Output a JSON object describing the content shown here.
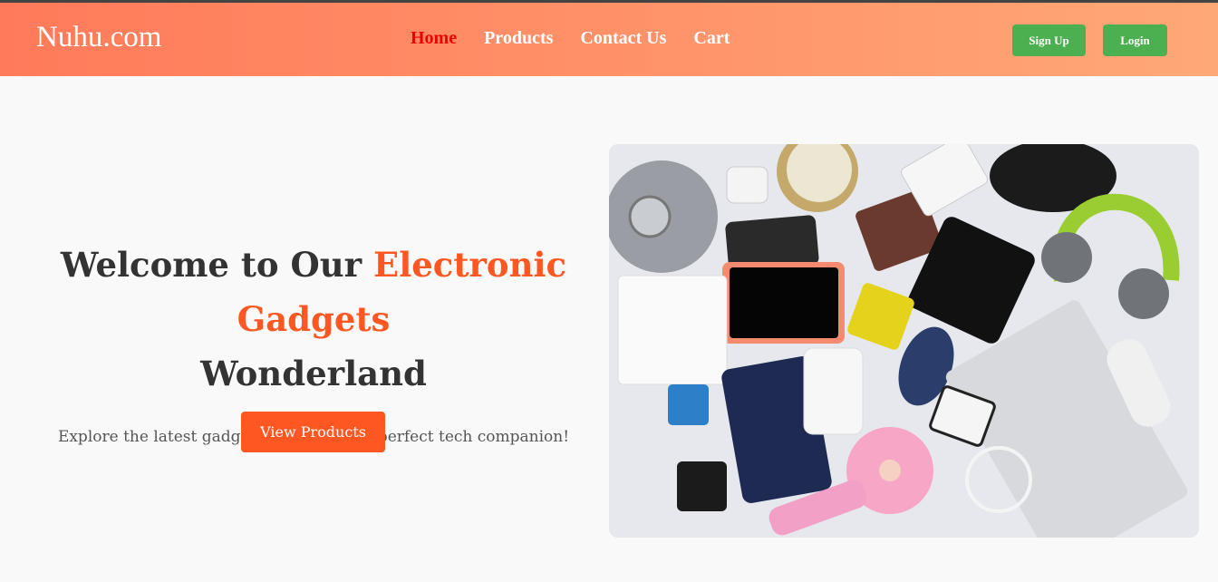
{
  "brand": {
    "name": "Nuhu.com"
  },
  "nav": {
    "items": [
      {
        "label": "Home",
        "active": true
      },
      {
        "label": "Products"
      },
      {
        "label": "Contact Us"
      },
      {
        "label": "Cart"
      }
    ]
  },
  "auth": {
    "signup_label": "Sign Up",
    "login_label": "Login"
  },
  "hero": {
    "title_prefix": "Welcome to Our ",
    "title_accent": "Electronic Gadgets",
    "title_suffix": "Wonderland",
    "subtitle": "Explore the latest gadgets and find your perfect tech companion!",
    "cta_label": "View Products"
  },
  "colors": {
    "accent": "#ff5722",
    "active_nav": "#ee0000",
    "button_green": "#4caf50"
  }
}
